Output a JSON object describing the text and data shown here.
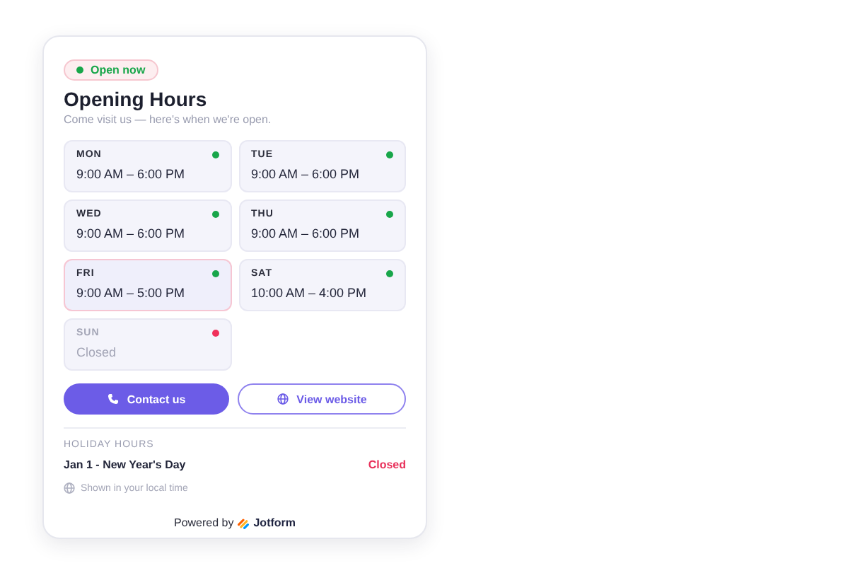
{
  "status_badge": {
    "label": "Open now",
    "open": true
  },
  "title": "Opening Hours",
  "subtitle": "Come visit us — here's when we're open.",
  "days": [
    {
      "day": "MON",
      "hours": "9:00 AM – 6:00 PM",
      "open": true,
      "selected": false
    },
    {
      "day": "TUE",
      "hours": "9:00 AM – 6:00 PM",
      "open": true,
      "selected": false
    },
    {
      "day": "WED",
      "hours": "9:00 AM – 6:00 PM",
      "open": true,
      "selected": false
    },
    {
      "day": "THU",
      "hours": "9:00 AM – 6:00 PM",
      "open": true,
      "selected": false
    },
    {
      "day": "FRI",
      "hours": "9:00 AM – 5:00 PM",
      "open": true,
      "selected": true
    },
    {
      "day": "SAT",
      "hours": "10:00 AM – 4:00 PM",
      "open": true,
      "selected": false
    },
    {
      "day": "SUN",
      "hours": "Closed",
      "open": false,
      "selected": false
    }
  ],
  "buttons": [
    {
      "label": "Contact us",
      "kind": "primary"
    },
    {
      "label": "View website",
      "kind": "secondary"
    }
  ],
  "holiday": {
    "heading": "HOLIDAY HOURS",
    "items": [
      {
        "name": "Jan 1 - New Year's Day",
        "status": "Closed"
      }
    ]
  },
  "timezone_note": "Shown in your local time",
  "footer": {
    "prefix": "Powered by",
    "brand": "Jotform"
  }
}
